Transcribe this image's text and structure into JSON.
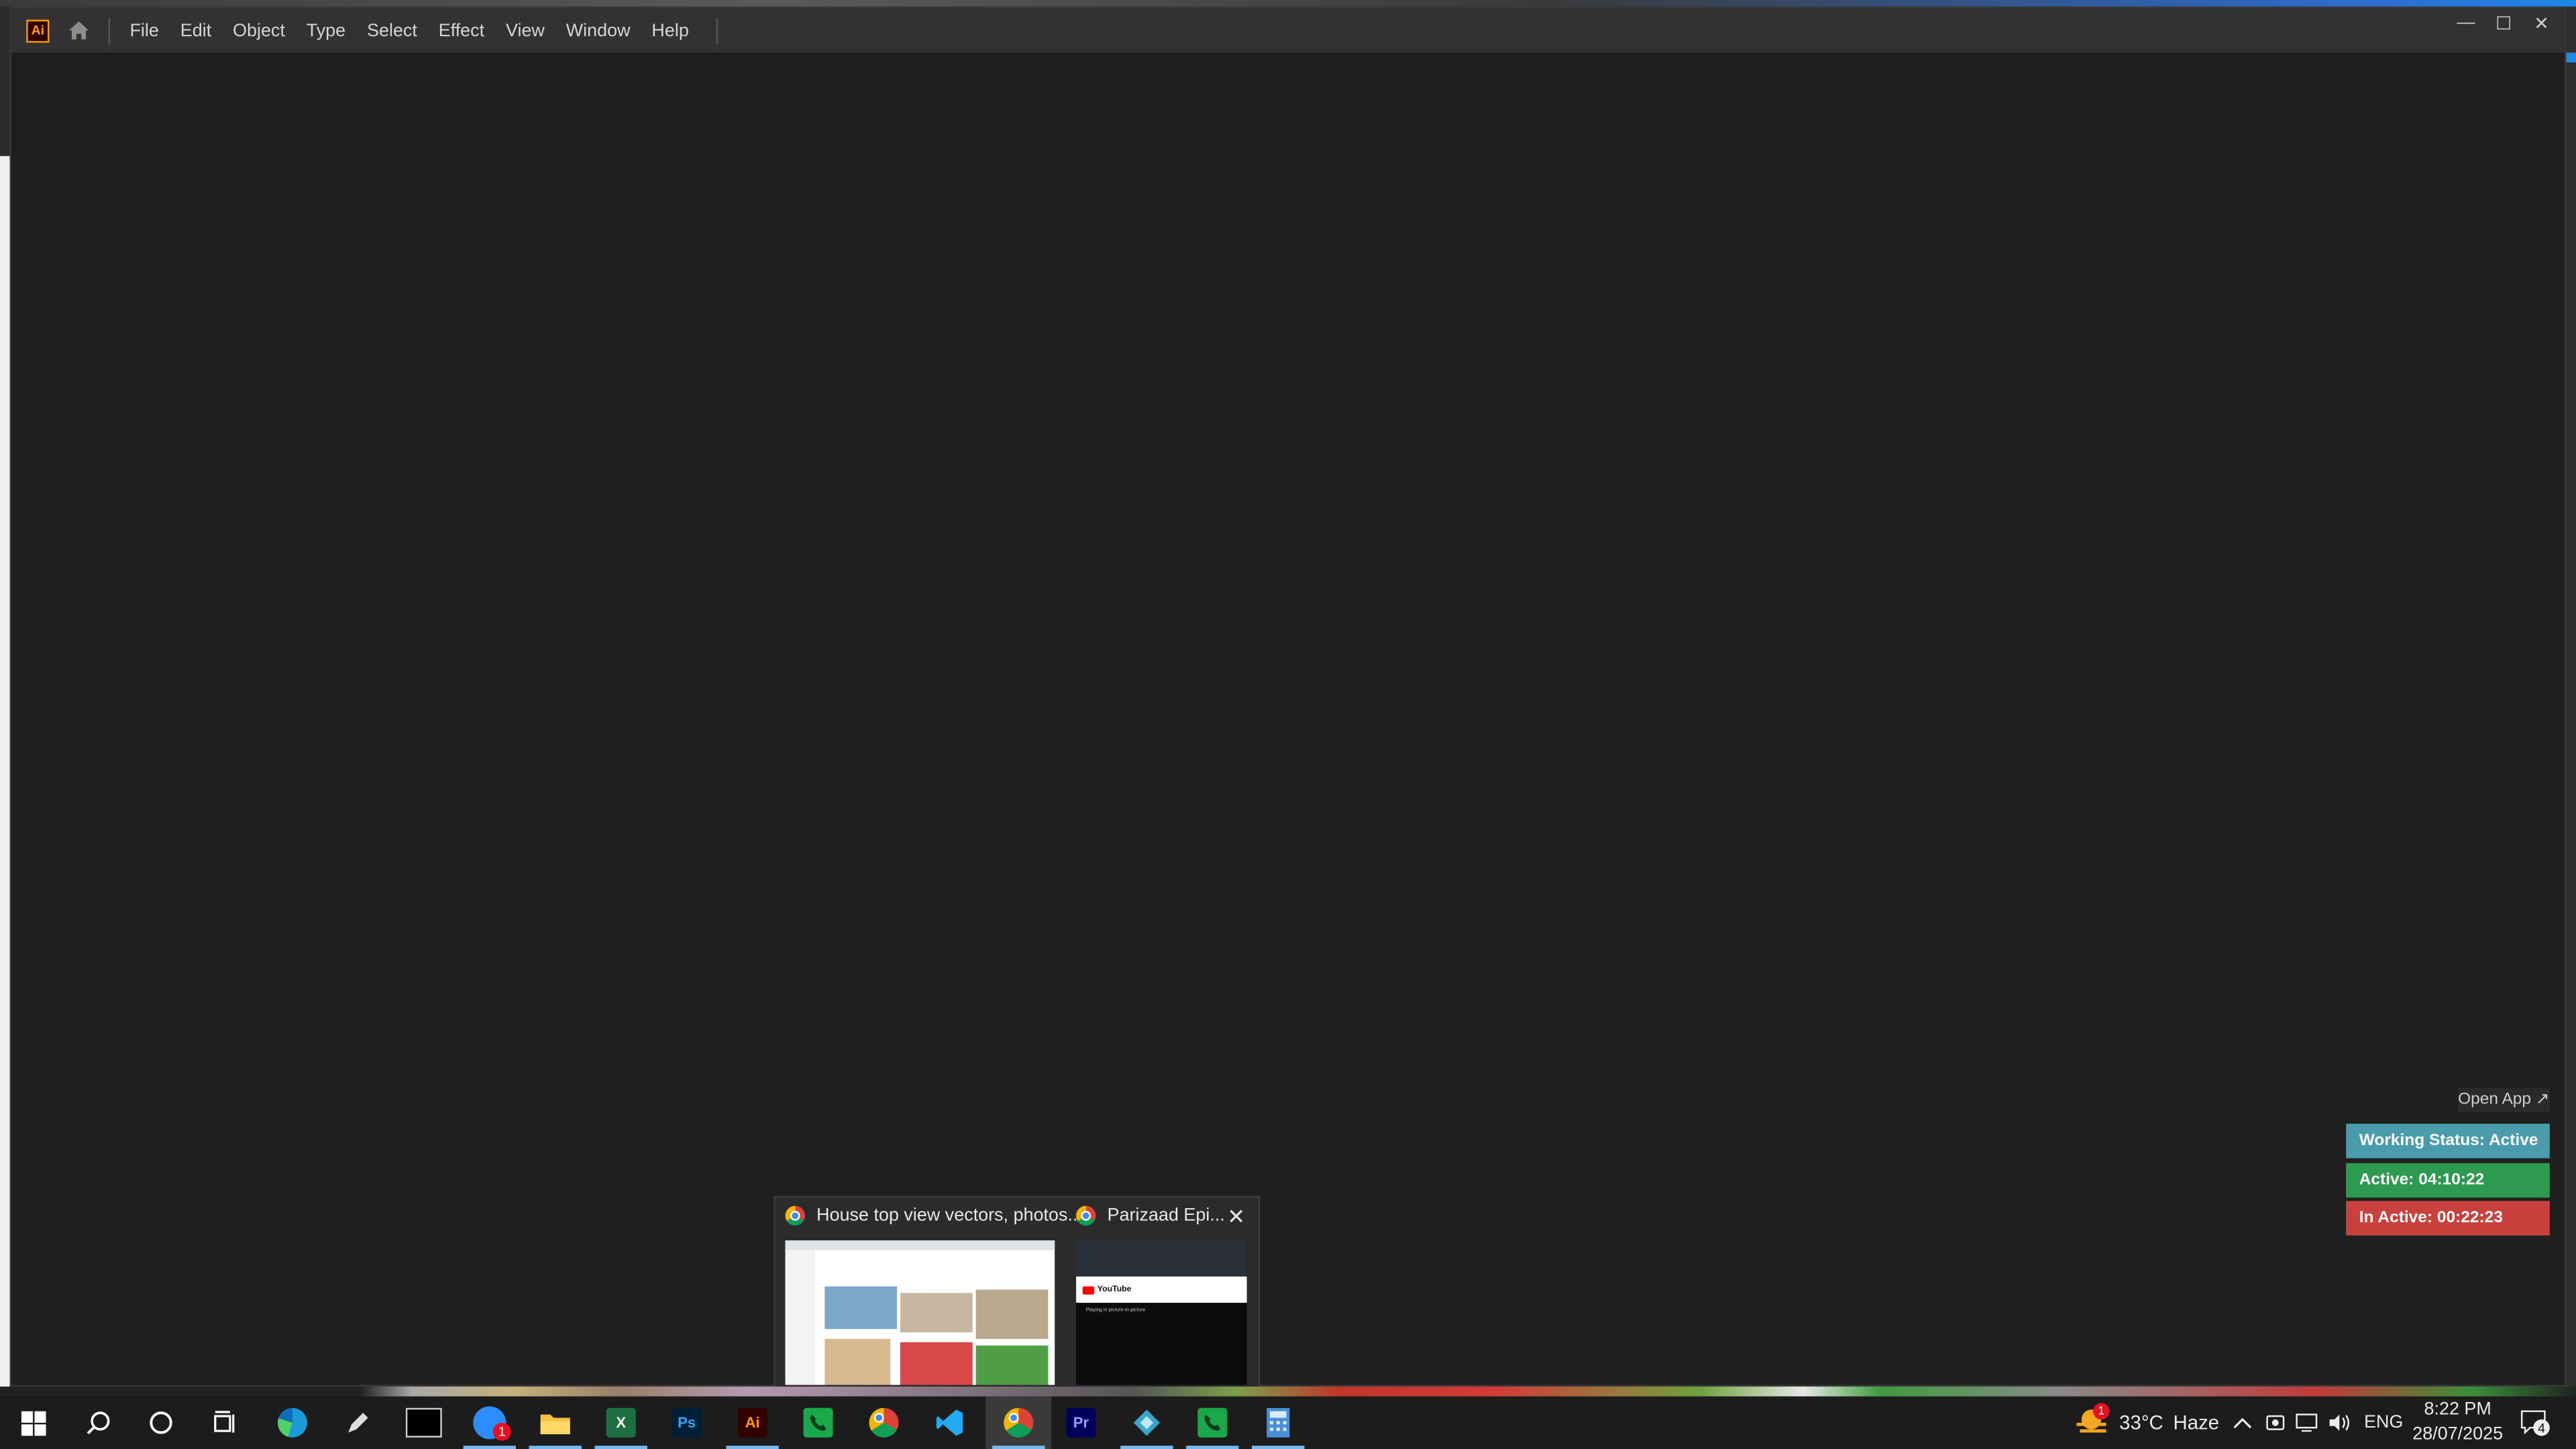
{
  "app": {
    "logo": "Ai",
    "menu": [
      "File",
      "Edit",
      "Object",
      "Type",
      "Select",
      "Effect",
      "View",
      "Window",
      "Help"
    ],
    "window_controls": {
      "minimize": "—",
      "maximize": "☐",
      "close": "✕"
    },
    "canvas_color": "#1f1f1f"
  },
  "widget": {
    "open_app": "Open App ↗",
    "working_status": "Working Status: Active",
    "active": "Active: 04:10:22",
    "inactive": "In Active: 00:22:23",
    "colors": {
      "status": "#4a9bab",
      "active": "#2e9a4f",
      "inactive": "#c8413c"
    }
  },
  "preview": {
    "cards": [
      {
        "title": "House top view vectors, photos...",
        "icon": "chrome-icon"
      },
      {
        "title": "Parizaad Epi...",
        "icon": "chrome-icon"
      }
    ],
    "close": "✕",
    "yt_thumb": {
      "logo": "YouTube",
      "text": "Playing in picture-in-picture"
    }
  },
  "taskbar": {
    "apps": [
      {
        "name": "start",
        "label": "",
        "icon": "windows-logo-icon"
      },
      {
        "name": "search",
        "label": "",
        "icon": "search-icon"
      },
      {
        "name": "cortana",
        "label": "",
        "icon": "cortana-icon"
      },
      {
        "name": "task-view",
        "label": "",
        "icon": "task-view-icon"
      },
      {
        "name": "edge",
        "label": "",
        "icon": "edge-icon"
      },
      {
        "name": "pen",
        "label": "",
        "icon": "pen-icon"
      },
      {
        "name": "terminal",
        "label": "",
        "icon": "terminal-icon"
      },
      {
        "name": "zoom",
        "label": "",
        "icon": "zoom-icon",
        "badge": "1"
      },
      {
        "name": "file-explorer",
        "label": "",
        "icon": "folder-icon"
      },
      {
        "name": "excel",
        "label": "X",
        "icon": "excel-icon"
      },
      {
        "name": "photoshop",
        "label": "Ps",
        "icon": "photoshop-icon"
      },
      {
        "name": "illustrator",
        "label": "Ai",
        "icon": "illustrator-icon"
      },
      {
        "name": "phone-app",
        "label": "",
        "icon": "phone-icon"
      },
      {
        "name": "chrome",
        "label": "",
        "icon": "chrome-icon"
      },
      {
        "name": "vscode",
        "label": "",
        "icon": "vscode-icon"
      },
      {
        "name": "chrome-profile",
        "label": "",
        "icon": "chrome-icon"
      },
      {
        "name": "premiere",
        "label": "Pr",
        "icon": "premiere-icon"
      },
      {
        "name": "app-diamond",
        "label": "",
        "icon": "diamond-icon"
      },
      {
        "name": "phone-app-2",
        "label": "",
        "icon": "phone-icon"
      },
      {
        "name": "calculator",
        "label": "",
        "icon": "calculator-icon"
      }
    ],
    "weather": {
      "temp": "33°C",
      "condition": "Haze",
      "badge": "1"
    },
    "language": "ENG",
    "time": "8:22 PM",
    "date": "28/07/2025",
    "notifications": "4"
  }
}
